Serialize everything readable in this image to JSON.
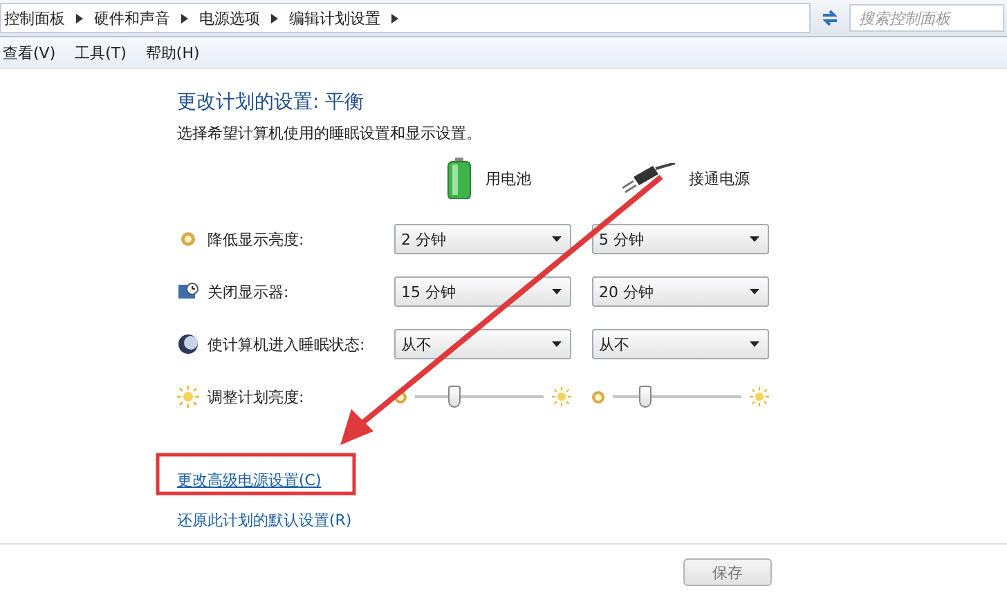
{
  "address_bar": {
    "breadcrumbs": [
      "控制面板",
      "硬件和声音",
      "电源选项",
      "编辑计划设置"
    ],
    "search": {
      "placeholder": "搜索控制面板"
    }
  },
  "menu": [
    "查看(V)",
    "工具(T)",
    "帮助(H)"
  ],
  "title": "更改计划的设置: 平衡",
  "subtitle": "选择希望计算机使用的睡眠设置和显示设置。",
  "columns": [
    {
      "kind": "battery",
      "label": "用电池"
    },
    {
      "kind": "plug",
      "label": "接通电源"
    }
  ],
  "settings": [
    {
      "label": "降低显示亮度:",
      "kind": "dropdown",
      "values": [
        "2 分钟",
        "5 分钟"
      ]
    },
    {
      "label": "关闭显示器:",
      "kind": "dropdown",
      "values": [
        "15 分钟",
        "20 分钟"
      ]
    },
    {
      "label": "使计算机进入睡眠状态:",
      "kind": "dropdown",
      "values": [
        "从不",
        "从不"
      ]
    },
    {
      "label": "调整计划亮度:",
      "kind": "slider",
      "sliders": [
        {
          "level": 0.3
        },
        {
          "level": 0.25
        }
      ]
    }
  ],
  "links": [
    {
      "label": "更改高级电源设置(C)",
      "highlighted": true
    },
    {
      "label": "还原此计划的默认设置(R)",
      "highlighted": false
    }
  ],
  "buttons": [
    "保存"
  ]
}
